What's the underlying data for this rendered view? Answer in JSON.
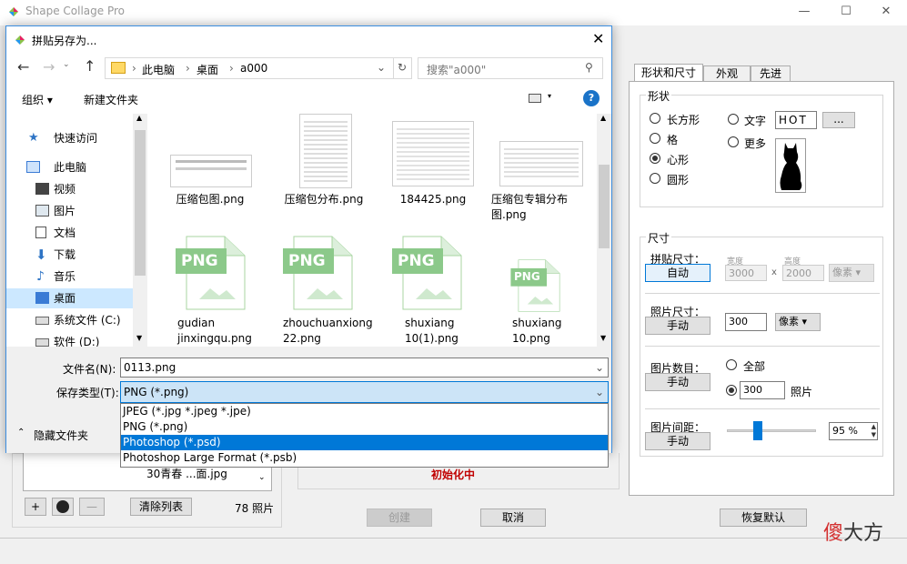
{
  "app": {
    "title": "Shape Collage Pro",
    "window_controls": [
      "—",
      "☐",
      "✕"
    ]
  },
  "main": {
    "tabs": [
      "形状和尺寸",
      "外观",
      "先进"
    ],
    "shape": {
      "group_label": "形状",
      "options": [
        "长方形",
        "格",
        "心形",
        "圆形"
      ],
      "text_option": "文字",
      "text_value": "HOT",
      "browse": "...",
      "more_option": "更多",
      "selected": "心形"
    },
    "size": {
      "group_label": "尺寸",
      "collage_size": {
        "label": "拼贴尺寸：",
        "button": "自动",
        "width_label": "宽度",
        "height_label": "高度",
        "width": "3000",
        "x": "x",
        "height": "2000",
        "unit": "像素"
      },
      "photo_size": {
        "label": "照片尺寸：",
        "button": "手动",
        "value": "300",
        "unit": "像素"
      },
      "photo_count": {
        "label": "图片数目：",
        "button": "手动",
        "all_label": "全部",
        "value": "300",
        "unit": "照片"
      },
      "spacing": {
        "label": "图片间距：",
        "button": "手动",
        "value": "95 %",
        "slider_fraction": 0.35
      }
    },
    "left_panel": {
      "file_item": "30青春 ...面.jpg",
      "add": "+",
      "remove": "—",
      "clear": "清除列表",
      "count": "78 照片"
    },
    "status": "初始化中",
    "buttons": {
      "create": "创建",
      "cancel": "取消",
      "reset": "恢复默认"
    }
  },
  "dialog": {
    "title": "拼贴另存为...",
    "breadcrumb": [
      "此电脑",
      "桌面",
      "a000"
    ],
    "search_placeholder": "搜索\"a000\"",
    "toolbar": {
      "organize": "组织 ▾",
      "new_folder": "新建文件夹"
    },
    "nav": [
      {
        "label": "快速访问",
        "icon": "star-icon"
      },
      {
        "label": "此电脑",
        "icon": "computer-icon"
      },
      {
        "label": "视频",
        "icon": "video-icon"
      },
      {
        "label": "图片",
        "icon": "picture-icon"
      },
      {
        "label": "文档",
        "icon": "document-icon"
      },
      {
        "label": "下载",
        "icon": "download-icon"
      },
      {
        "label": "音乐",
        "icon": "music-icon"
      },
      {
        "label": "桌面",
        "icon": "desktop-icon"
      },
      {
        "label": "系统文件 (C:)",
        "icon": "drive-icon"
      },
      {
        "label": "软件 (D:)",
        "icon": "drive-icon"
      }
    ],
    "files": [
      {
        "name": "压缩包图.png",
        "kind": "thumb"
      },
      {
        "name": "压缩包分布.png",
        "kind": "thumb"
      },
      {
        "name": "184425.png",
        "kind": "thumb"
      },
      {
        "name": "压缩包专辑分布图.png",
        "kind": "thumb"
      },
      {
        "name": "gudian jinxingqu.png",
        "kind": "png"
      },
      {
        "name": "zhouchuanxiong 22.png",
        "kind": "png"
      },
      {
        "name": "shuxiang 10(1).png",
        "kind": "png"
      },
      {
        "name": "shuxiang 10.png",
        "kind": "png"
      }
    ],
    "png_badge": "PNG",
    "filename_label": "文件名(N):",
    "filename_value": "0113.png",
    "filetype_label": "保存类型(T):",
    "filetype_value": "PNG (*.png)",
    "filetype_options": [
      "JPEG (*.jpg *.jpeg *.jpe)",
      "PNG (*.png)",
      "Photoshop (*.psd)",
      "Photoshop Large Format (*.psb)"
    ],
    "filetype_highlight": "Photoshop (*.psd)",
    "hide_folders": "隐藏文件夹"
  },
  "watermark": {
    "text1": "傻",
    "text2": "大方"
  }
}
